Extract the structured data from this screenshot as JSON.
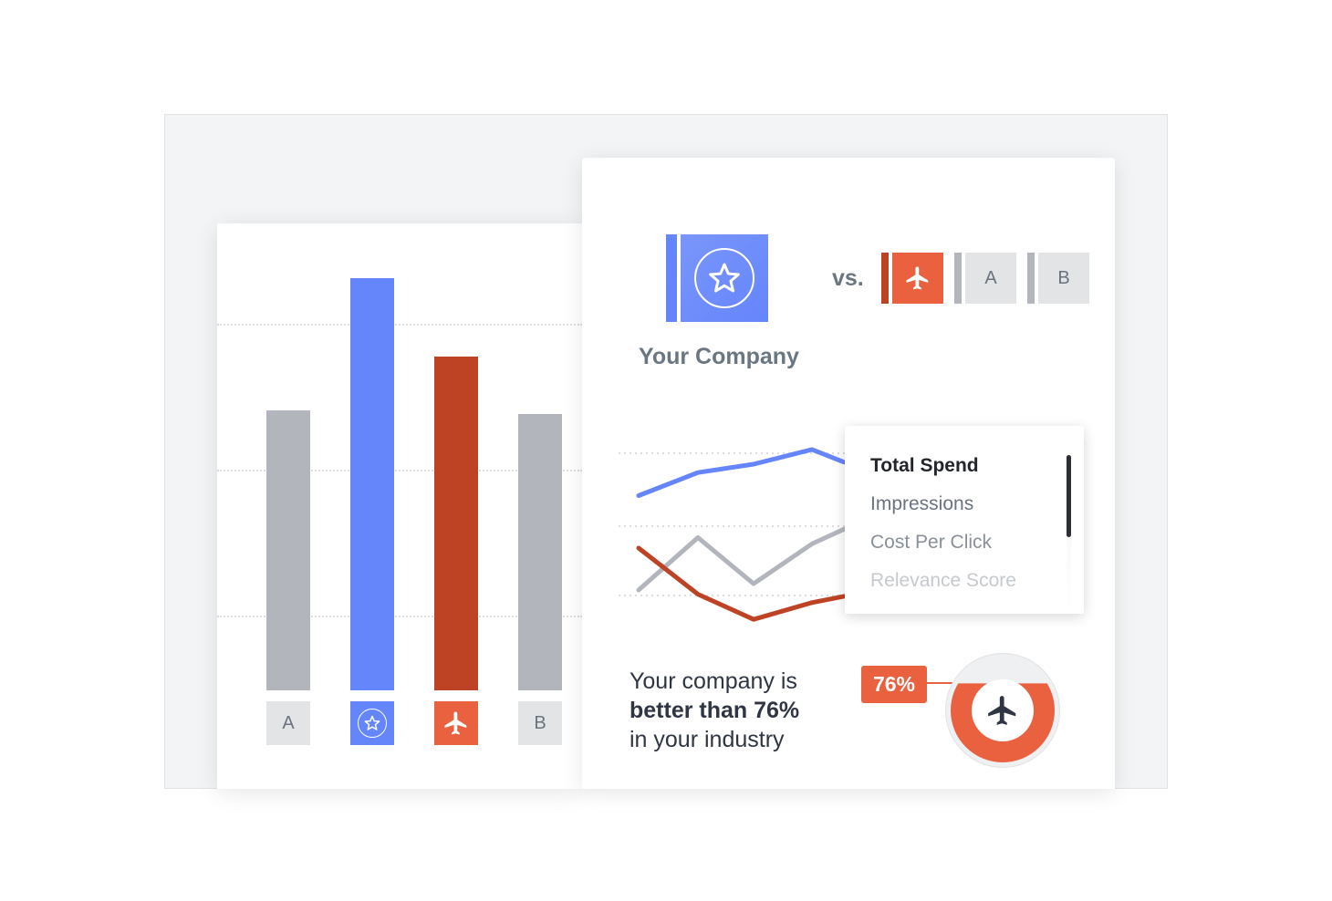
{
  "colors": {
    "blue": "#6585fb",
    "red": "#bd4324",
    "orange": "#ea6140",
    "gray": "#b2b6bc",
    "light_gray": "#e3e4e6",
    "dark": "#2f3542",
    "slate": "#6b7683"
  },
  "chart_data": [
    {
      "type": "bar",
      "categories": [
        "A",
        "star",
        "plane",
        "B"
      ],
      "values": [
        0.68,
        1.0,
        0.81,
        0.67
      ],
      "value_scale": "relative to tallest bar",
      "category_labels": [
        "A",
        "",
        "",
        "B"
      ],
      "category_icons": [
        "",
        "star-icon",
        "plane-icon",
        ""
      ],
      "grid": true
    },
    {
      "type": "line",
      "x": [
        1,
        2,
        3,
        4,
        5
      ],
      "series": [
        {
          "color": "#6585fb",
          "values": [
            65,
            76,
            80,
            87,
            81
          ]
        },
        {
          "color": "#b2b6bc",
          "values": [
            20,
            45,
            23,
            42,
            49
          ]
        },
        {
          "color": "#bd4324",
          "values": [
            40,
            18,
            6,
            14,
            17
          ]
        }
      ],
      "ylim": [
        0,
        100
      ],
      "grid": true
    }
  ],
  "header": {
    "company_label": "Your Company",
    "company_icon": "star-icon",
    "vs_label": "vs.",
    "competitors": [
      {
        "icon": "plane-icon",
        "label": ""
      },
      {
        "label": "A"
      },
      {
        "label": "B"
      }
    ]
  },
  "metric_menu": {
    "items": [
      "Total Spend",
      "Impressions",
      "Cost Per Click",
      "Relevance Score"
    ],
    "selected": "Total Spend"
  },
  "summary": {
    "line1": "Your company is",
    "line2": "better than 76%",
    "line3": "in your industry"
  },
  "gauge": {
    "badge": "76%",
    "percent": 76,
    "icon": "plane-icon"
  }
}
